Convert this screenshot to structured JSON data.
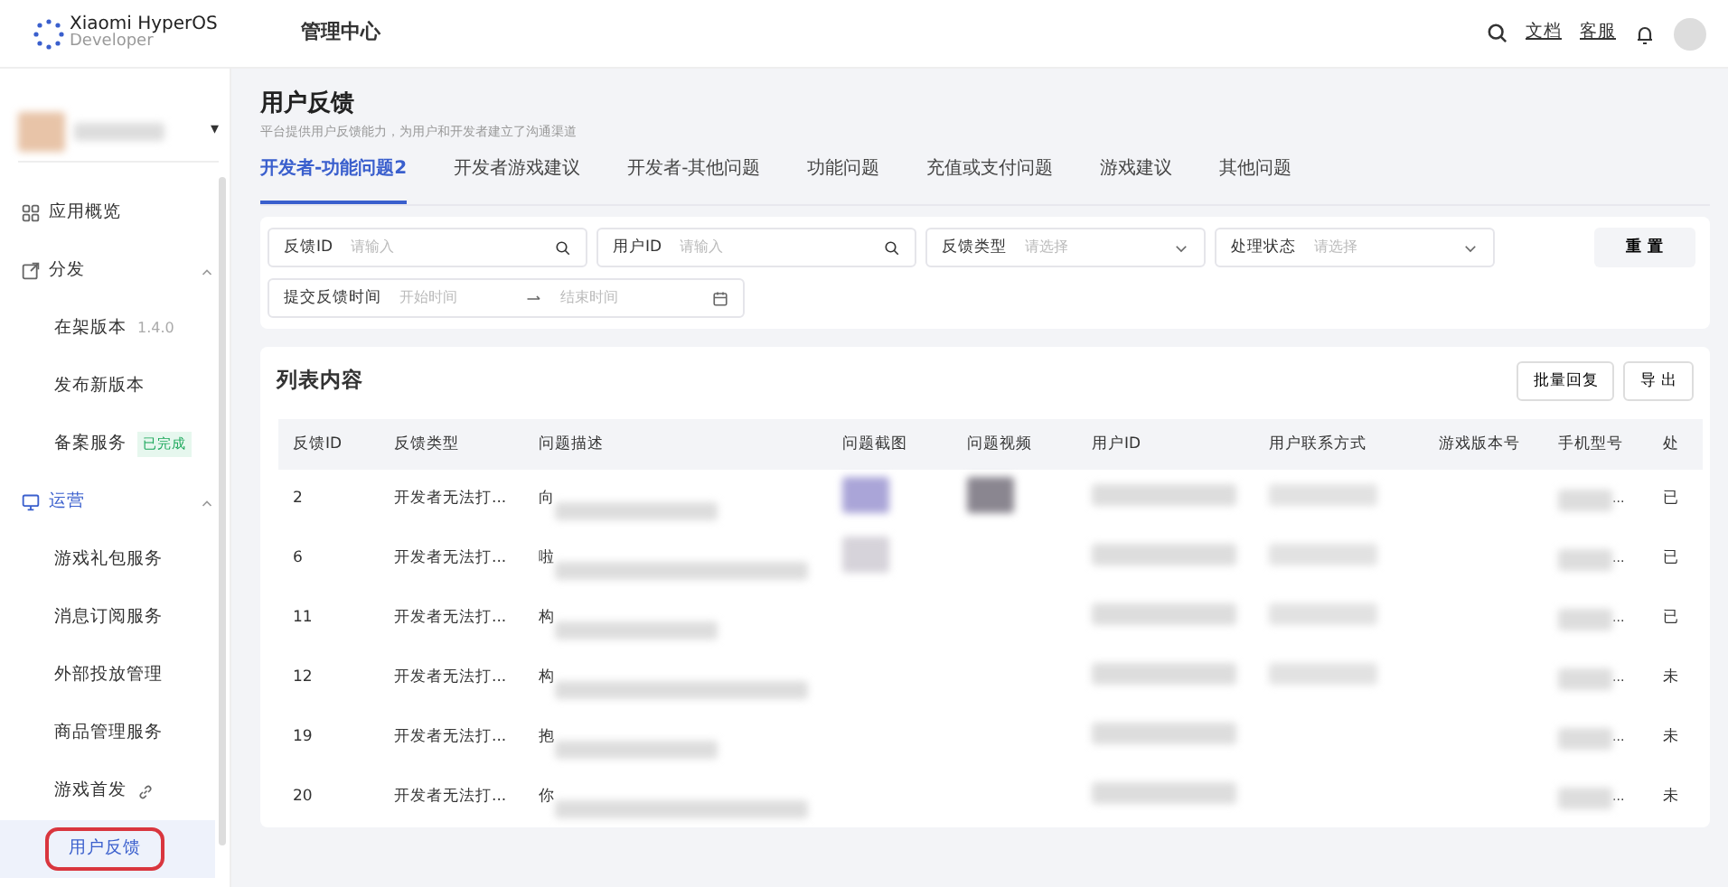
{
  "topbar": {
    "brand": "Xiaomi HyperOS",
    "brand_sub": "Developer",
    "title": "管理中心",
    "links": [
      "文档",
      "客服"
    ]
  },
  "sidebar": {
    "account_caret": "▾",
    "items": [
      {
        "kind": "item",
        "label": "应用概览",
        "selected": false
      },
      {
        "kind": "group",
        "label": "分发",
        "expanded": true,
        "selected": false
      },
      {
        "kind": "sub",
        "label": "在架版本",
        "note": "1.4.0",
        "selected": false
      },
      {
        "kind": "sub",
        "label": "发布新版本",
        "selected": false
      },
      {
        "kind": "sub",
        "label": "备案服务",
        "badge": "已完成",
        "selected": false
      },
      {
        "kind": "group",
        "label": "运营",
        "expanded": true,
        "selected": true
      },
      {
        "kind": "sub",
        "label": "游戏礼包服务",
        "selected": false
      },
      {
        "kind": "sub",
        "label": "消息订阅服务",
        "selected": false
      },
      {
        "kind": "sub",
        "label": "外部投放管理",
        "selected": false
      },
      {
        "kind": "sub",
        "label": "商品管理服务",
        "selected": false
      },
      {
        "kind": "sub",
        "label": "游戏首发",
        "link": true,
        "selected": false
      },
      {
        "kind": "sub",
        "label": "用户反馈",
        "selected": true
      }
    ]
  },
  "page": {
    "title": "用户反馈",
    "subtitle": "平台提供用户反馈能力，为用户和开发者建立了沟通渠道"
  },
  "tabs": [
    {
      "label": "开发者-功能问题2",
      "selected": true
    },
    {
      "label": "开发者游戏建议",
      "selected": false
    },
    {
      "label": "开发者-其他问题",
      "selected": false
    },
    {
      "label": "功能问题",
      "selected": false
    },
    {
      "label": "充值或支付问题",
      "selected": false
    },
    {
      "label": "游戏建议",
      "selected": false
    },
    {
      "label": "其他问题",
      "selected": false
    }
  ],
  "filters": [
    {
      "kind": "search",
      "label": "反馈ID",
      "placeholder": "请输入"
    },
    {
      "kind": "search",
      "label": "用户ID",
      "placeholder": "请输入"
    },
    {
      "kind": "select",
      "label": "反馈类型",
      "placeholder": "请选择"
    },
    {
      "kind": "select",
      "label": "处理状态",
      "placeholder": "请选择"
    },
    {
      "kind": "daterange",
      "label": "提交反馈时间",
      "placeholder": "开始时间",
      "placeholder_end": "结束时间"
    }
  ],
  "reset_button": "重 置",
  "list": {
    "title": "列表内容",
    "buttons": [
      "批量回复",
      "导 出"
    ],
    "columns": [
      "反馈ID",
      "反馈类型",
      "问题描述",
      "问题截图",
      "问题视频",
      "用户ID",
      "用户联系方式",
      "游戏版本号",
      "手机型号",
      "处"
    ],
    "rows": [
      {
        "id": "2",
        "type": "开发者无法打...",
        "desc": "向",
        "screenshot": true,
        "video": true,
        "phone": "...",
        "status": "已"
      },
      {
        "id": "6",
        "type": "开发者无法打...",
        "desc": "啦",
        "screenshot": true,
        "video": false,
        "phone": "...",
        "status": "已"
      },
      {
        "id": "11",
        "type": "开发者无法打...",
        "desc": "构",
        "screenshot": false,
        "video": false,
        "phone": "...",
        "status": "已"
      },
      {
        "id": "12",
        "type": "开发者无法打...",
        "desc": "构",
        "screenshot": false,
        "video": false,
        "phone": "...",
        "status": "未"
      },
      {
        "id": "19",
        "type": "开发者无法打...",
        "desc": "抱",
        "screenshot": false,
        "video": false,
        "phone": "...",
        "status": "未"
      },
      {
        "id": "20",
        "type": "开发者无法打...",
        "desc": "你",
        "screenshot": false,
        "video": false,
        "phone": "...",
        "status": "未"
      }
    ]
  }
}
